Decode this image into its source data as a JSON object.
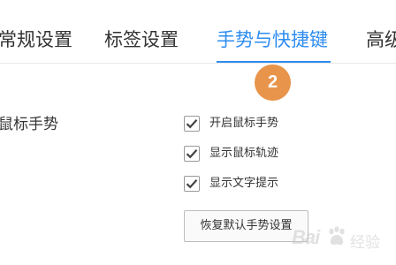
{
  "tabs": [
    {
      "label": "常规设置",
      "active": false
    },
    {
      "label": "标签设置",
      "active": false
    },
    {
      "label": "手势与快捷键",
      "active": true
    },
    {
      "label": "高级"
    }
  ],
  "accent_color": "#2d8cf0",
  "step_badge": {
    "number": "2",
    "color": "#e8944b"
  },
  "mouse_gesture": {
    "label": "鼠标手势",
    "options": [
      {
        "label": "开启鼠标手势",
        "checked": true
      },
      {
        "label": "显示鼠标轨迹",
        "checked": true
      },
      {
        "label": "显示文字提示",
        "checked": true
      }
    ],
    "reset_button": "恢复默认手势设置"
  },
  "watermark": {
    "brand": "Bai",
    "suffix": "经验"
  }
}
